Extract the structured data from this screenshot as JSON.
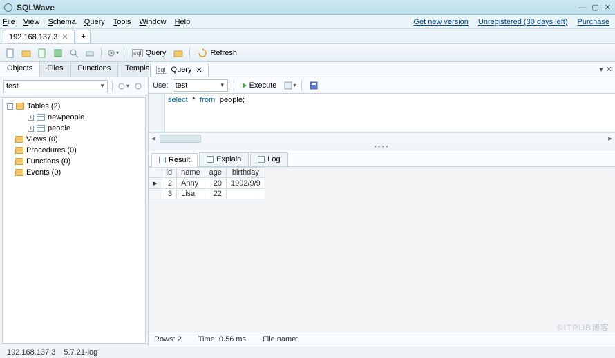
{
  "app": {
    "title": "SQLWave"
  },
  "window_buttons": {
    "min": "—",
    "max": "▢",
    "close": "✕"
  },
  "menubar": [
    "File",
    "View",
    "Schema",
    "Query",
    "Tools",
    "Window",
    "Help"
  ],
  "menubar_links": [
    "Get new version",
    "Unregistered (30 days left)",
    "Purchase"
  ],
  "connection_tab": {
    "label": "192.168.137.3",
    "add": "+"
  },
  "toolbar": {
    "query_label": "Query",
    "refresh_label": "Refresh"
  },
  "sidebar": {
    "tabs": [
      "Objects",
      "Files",
      "Functions",
      "Templates"
    ],
    "db_value": "test",
    "tree": {
      "tables": {
        "label": "Tables (2)",
        "items": [
          "newpeople",
          "people"
        ]
      },
      "views": "Views (0)",
      "procedures": "Procedures (0)",
      "functions": "Functions (0)",
      "events": "Events (0)"
    }
  },
  "editor_panel": {
    "tab_label": "Query",
    "use_label": "Use:",
    "use_value": "test",
    "execute_label": "Execute",
    "sql": {
      "raw": "select * from people;",
      "kw1": "select",
      "star": "*",
      "kw2": "from",
      "tbl": "people",
      "semi": ";"
    }
  },
  "result_tabs": [
    "Result",
    "Explain",
    "Log"
  ],
  "result": {
    "columns": [
      "",
      "id",
      "name",
      "age",
      "birthday"
    ],
    "rows": [
      {
        "marker": "▸",
        "id": "2",
        "name": "Anny",
        "age": "20",
        "birthday": "1992/9/9"
      },
      {
        "marker": "",
        "id": "3",
        "name": "Lisa",
        "age": "22",
        "birthday": ""
      }
    ]
  },
  "status": {
    "rows": "Rows: 2",
    "time": "Time: 0.56 ms",
    "filename": "File name:"
  },
  "bottom": {
    "host": "192.168.137.3",
    "version": "5.7.21-log"
  },
  "watermark": "©ITPUB博客"
}
